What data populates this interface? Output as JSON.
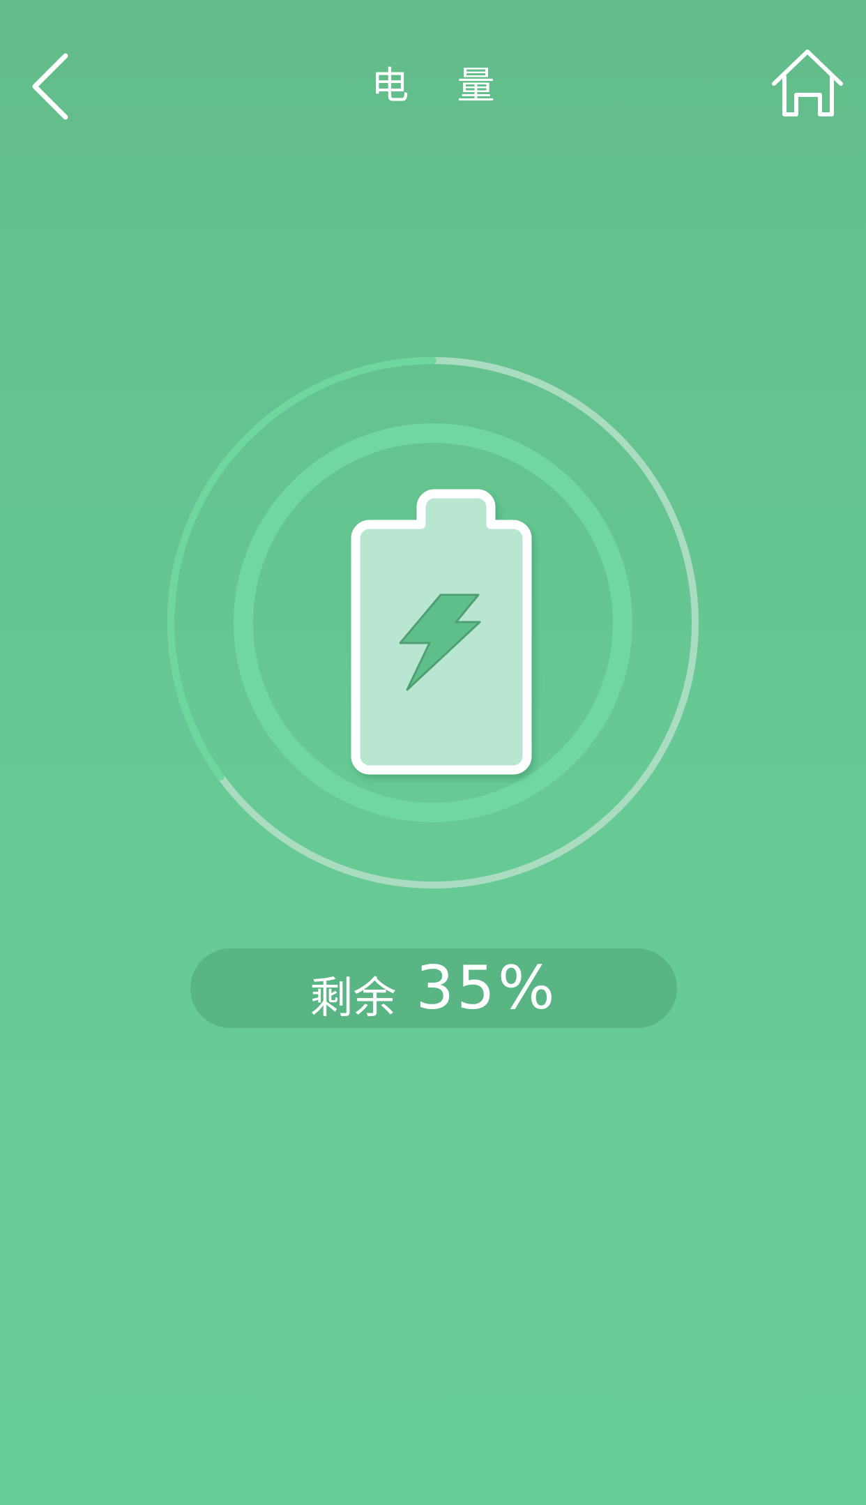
{
  "header": {
    "title": "电 量",
    "back_icon": "chevron-left-icon",
    "home_icon": "home-icon"
  },
  "battery": {
    "level_fraction": 0.35,
    "remaining_label": "剩余",
    "remaining_value": "35%",
    "icon": "battery-charging-icon"
  },
  "colors": {
    "background_top": "#62bc8a",
    "background_bottom": "#68ce97",
    "ring_progress": "#6ed79e",
    "ring_track": "#a9dcc1",
    "inner_ring": "#6fd79f",
    "pill": "#5ab584",
    "battery_fill": "#b9e6d1"
  }
}
